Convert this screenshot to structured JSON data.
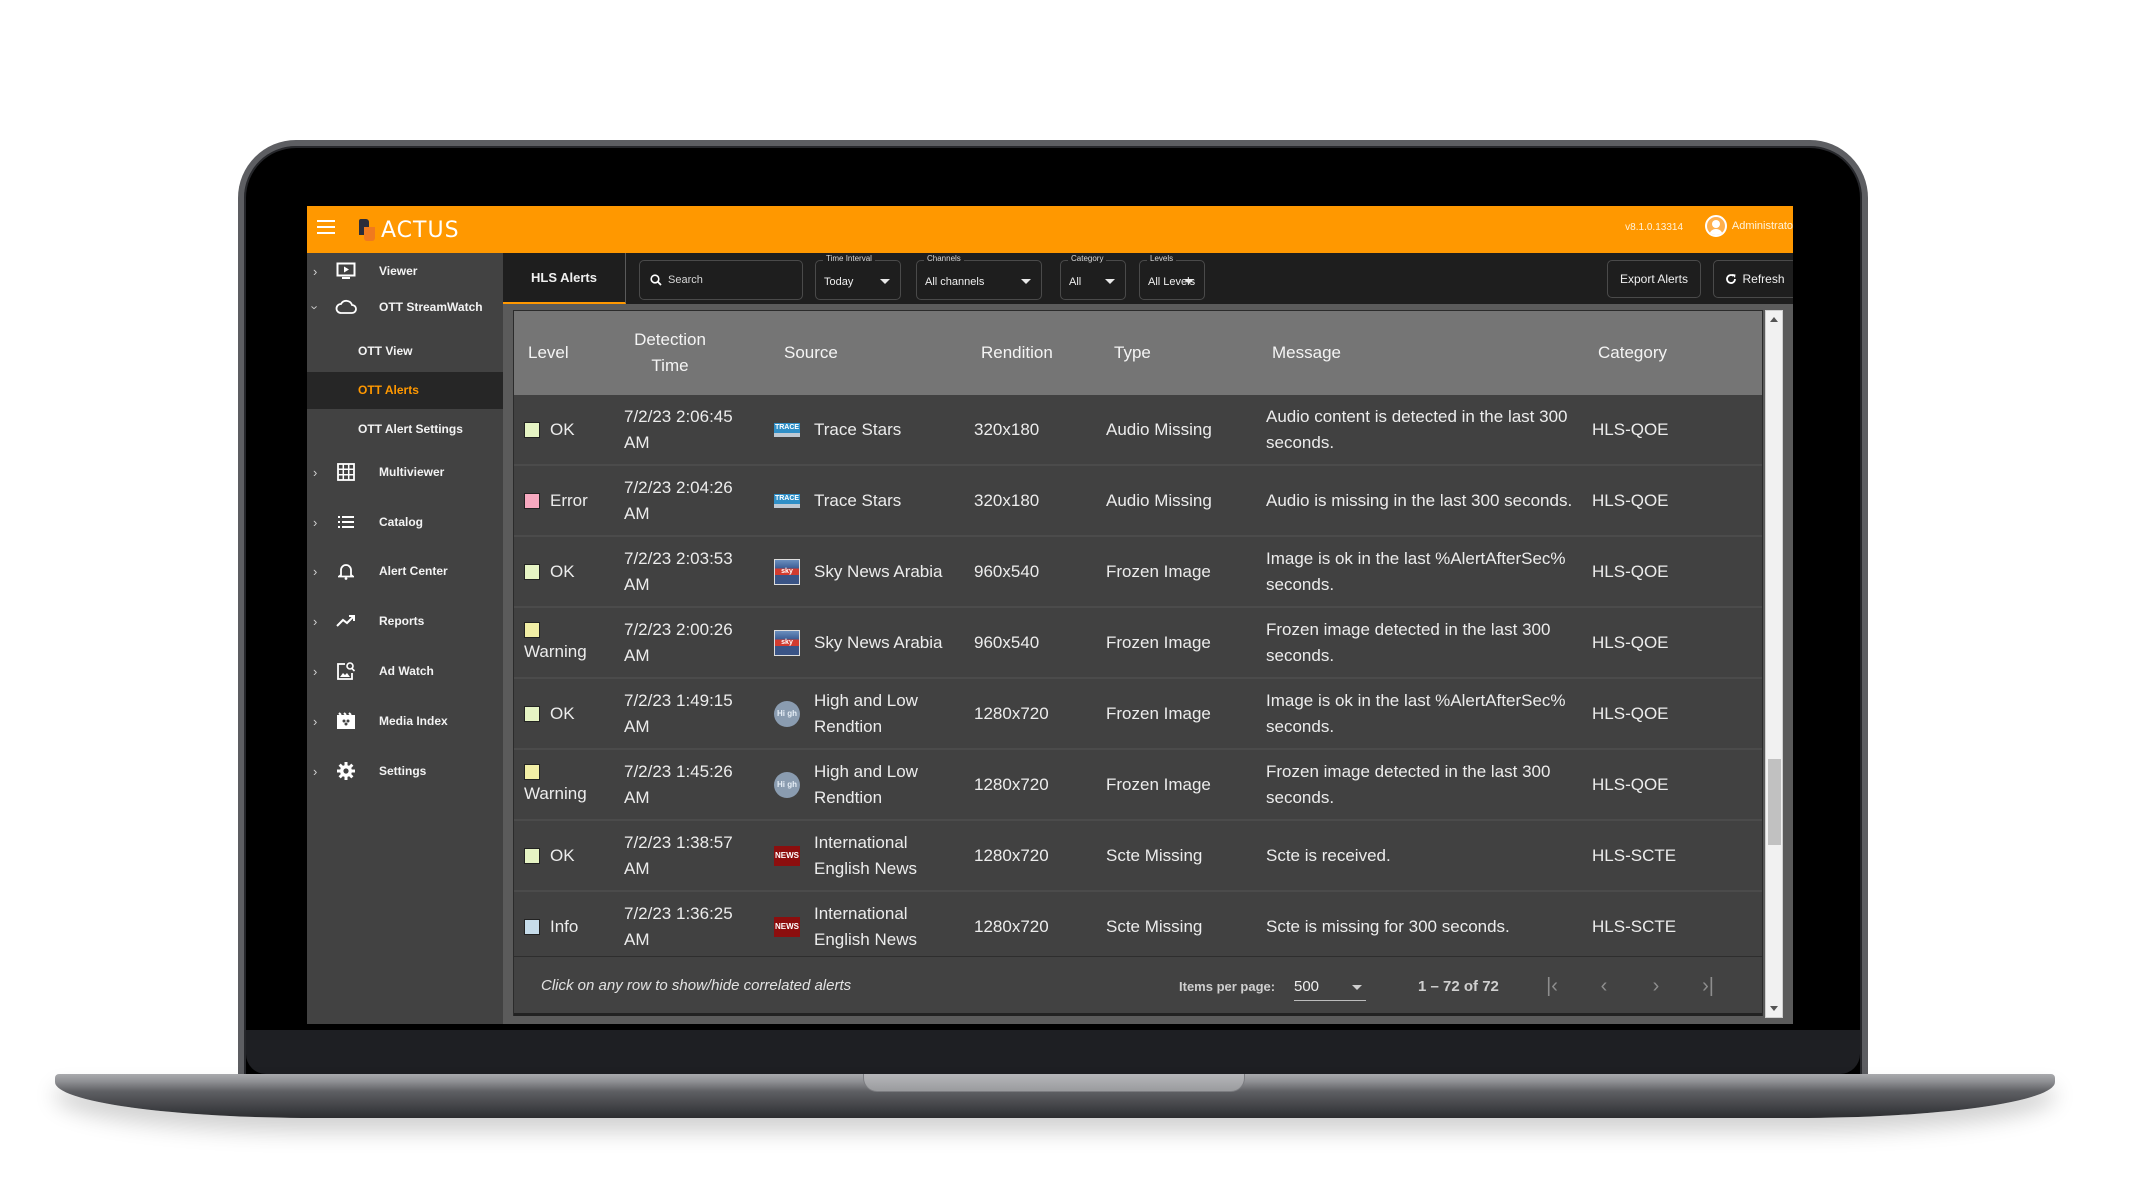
{
  "app": {
    "brand": "ACTUS",
    "version": "v8.1.0.13314",
    "user": "Administrato"
  },
  "sidebar": {
    "items": [
      {
        "label": "Viewer",
        "icon": "monitor-play-icon",
        "expanded": false
      },
      {
        "label": "OTT StreamWatch",
        "icon": "cloud-icon",
        "expanded": true,
        "children": [
          {
            "label": "OTT View",
            "active": false
          },
          {
            "label": "OTT Alerts",
            "active": true
          },
          {
            "label": "OTT Alert Settings",
            "active": false
          }
        ]
      },
      {
        "label": "Multiviewer",
        "icon": "grid-icon",
        "expanded": false
      },
      {
        "label": "Catalog",
        "icon": "list-icon",
        "expanded": false
      },
      {
        "label": "Alert Center",
        "icon": "bell-icon",
        "expanded": false
      },
      {
        "label": "Reports",
        "icon": "trending-up-icon",
        "expanded": false
      },
      {
        "label": "Ad Watch",
        "icon": "image-search-icon",
        "expanded": false
      },
      {
        "label": "Media Index",
        "icon": "clapperboard-icon",
        "expanded": false
      },
      {
        "label": "Settings",
        "icon": "gear-icon",
        "expanded": false
      }
    ]
  },
  "toolbar": {
    "tab": "HLS Alerts",
    "search_placeholder": "Search",
    "filters": [
      {
        "label": "Time Interval",
        "value": "Today"
      },
      {
        "label": "Channels",
        "value": "All channels"
      },
      {
        "label": "Category",
        "value": "All"
      },
      {
        "label": "Levels",
        "value": "All Levels"
      }
    ],
    "export_label": "Export Alerts",
    "refresh_label": "Refresh"
  },
  "table": {
    "columns": [
      "Level",
      "Detection Time",
      "Source",
      "Rendition",
      "Type",
      "Message",
      "Category"
    ],
    "level_colors": {
      "OK": "#e6f4c4",
      "Error": "#f7a9c0",
      "Warning": "#f2efa6",
      "Info": "#c6dcea"
    },
    "rows": [
      {
        "level": "OK",
        "time": "7/2/23 2:06:45 AM",
        "source": "Trace Stars",
        "logo": "trace",
        "rendition": "320x180",
        "type": "Audio Missing",
        "message": "Audio content is detected in the last 300 seconds.",
        "category": "HLS-QOE"
      },
      {
        "level": "Error",
        "time": "7/2/23 2:04:26 AM",
        "source": "Trace Stars",
        "logo": "trace",
        "rendition": "320x180",
        "type": "Audio Missing",
        "message": "Audio is missing in the last 300 seconds.",
        "category": "HLS-QOE"
      },
      {
        "level": "OK",
        "time": "7/2/23 2:03:53 AM",
        "source": "Sky News Arabia",
        "logo": "sky",
        "rendition": "960x540",
        "type": "Frozen Image",
        "message": "Image is ok in the last %AlertAfterSec% seconds.",
        "category": "HLS-QOE"
      },
      {
        "level": "Warning",
        "time": "7/2/23 2:00:26 AM",
        "source": "Sky News Arabia",
        "logo": "sky",
        "rendition": "960x540",
        "type": "Frozen Image",
        "message": "Frozen image detected in the last 300 seconds.",
        "category": "HLS-QOE"
      },
      {
        "level": "OK",
        "time": "7/2/23 1:49:15 AM",
        "source": "High and Low Rendtion",
        "logo": "high",
        "rendition": "1280x720",
        "type": "Frozen Image",
        "message": "Image is ok in the last %AlertAfterSec% seconds.",
        "category": "HLS-QOE"
      },
      {
        "level": "Warning",
        "time": "7/2/23 1:45:26 AM",
        "source": "High and Low Rendtion",
        "logo": "high",
        "rendition": "1280x720",
        "type": "Frozen Image",
        "message": "Frozen image detected in the last 300 seconds.",
        "category": "HLS-QOE"
      },
      {
        "level": "OK",
        "time": "7/2/23 1:38:57 AM",
        "source": "International English News",
        "logo": "news",
        "rendition": "1280x720",
        "type": "Scte Missing",
        "message": "Scte is received.",
        "category": "HLS-SCTE"
      },
      {
        "level": "Info",
        "time": "7/2/23 1:36:25 AM",
        "source": "International English News",
        "logo": "news",
        "rendition": "1280x720",
        "type": "Scte Missing",
        "message": "Scte is missing for 300 seconds.",
        "category": "HLS-SCTE"
      }
    ],
    "footer_hint": "Click on any row to show/hide correlated alerts",
    "items_per_page_label": "Items per page:",
    "items_per_page": "500",
    "range_label": "1 – 72 of 72"
  },
  "logos": {
    "trace": "TRACE",
    "sky": "sky",
    "high": "Hi gh",
    "news": "NEWS"
  }
}
